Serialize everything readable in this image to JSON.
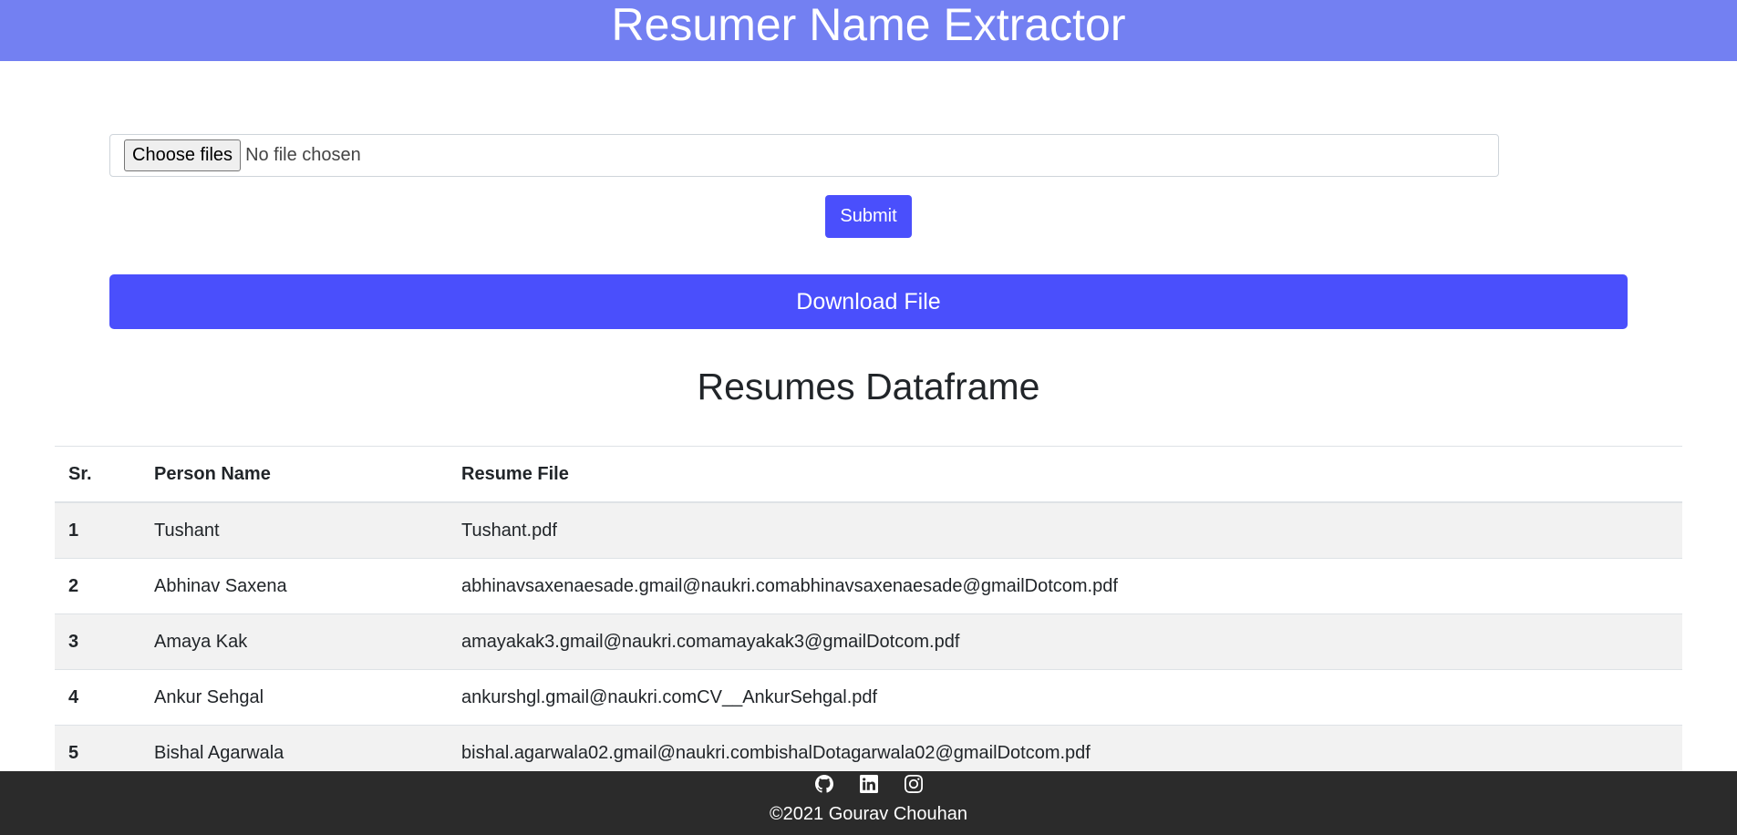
{
  "header": {
    "title": "Resumer Name Extractor"
  },
  "upload": {
    "choose_label": "Choose files",
    "status_text": "No file chosen",
    "submit_label": "Submit"
  },
  "download": {
    "label": "Download File"
  },
  "section": {
    "title": "Resumes Dataframe"
  },
  "table": {
    "headers": [
      "Sr.",
      "Person Name",
      "Resume File"
    ],
    "rows": [
      {
        "sr": "1",
        "name": "Tushant",
        "file": "Tushant.pdf"
      },
      {
        "sr": "2",
        "name": "Abhinav Saxena",
        "file": "abhinavsaxenaesade.gmail@naukri.comabhinavsaxenaesade@gmailDotcom.pdf"
      },
      {
        "sr": "3",
        "name": "Amaya Kak",
        "file": "amayakak3.gmail@naukri.comamayakak3@gmailDotcom.pdf"
      },
      {
        "sr": "4",
        "name": "Ankur Sehgal",
        "file": "ankurshgl.gmail@naukri.comCV__AnkurSehgal.pdf"
      },
      {
        "sr": "5",
        "name": "Bishal Agarwala",
        "file": "bishal.agarwala02.gmail@naukri.combishalDotagarwala02@gmailDotcom.pdf"
      }
    ]
  },
  "footer": {
    "icons": [
      "github-icon",
      "linkedin-icon",
      "instagram-icon"
    ],
    "copyright": "©2021 Gourav Chouhan"
  },
  "colors": {
    "header_bg": "#7380f2",
    "accent": "#4a4ffc",
    "footer_bg": "#2b2b2b"
  }
}
